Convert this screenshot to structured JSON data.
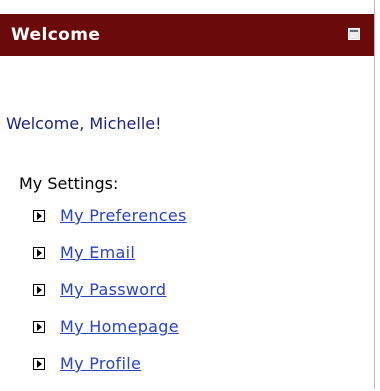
{
  "header": {
    "title": "Welcome",
    "background_color": "#6b0a0a",
    "collapse_icon": "minimize-icon"
  },
  "greeting": "Welcome, Michelle!",
  "settings": {
    "label": "My Settings:",
    "bullet_icon": "arrow-box-icon",
    "link_color": "#2a43c2",
    "items": [
      {
        "label": "My Preferences"
      },
      {
        "label": "My Email"
      },
      {
        "label": "My Password"
      },
      {
        "label": "My Homepage"
      },
      {
        "label": "My Profile"
      }
    ]
  }
}
